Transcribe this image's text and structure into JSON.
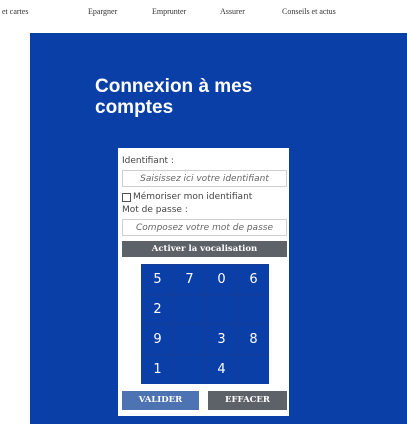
{
  "nav": {
    "items": [
      "et cartes",
      "Epargner",
      "Emprunter",
      "Assurer",
      "Conseils et actus"
    ]
  },
  "login": {
    "title": "Connexion à mes comptes",
    "identifier_label": "Identifiant :",
    "identifier_placeholder": "Saisissez ici votre identifiant",
    "remember_label": "Mémoriser mon identifiant",
    "remember_checked": false,
    "password_label": "Mot de passe :",
    "password_placeholder": "Composez votre mot de passe",
    "vocalisation_label": "Activer la vocalisation",
    "keypad": [
      "5",
      "7",
      "0",
      "6",
      "2",
      "",
      "",
      "",
      "9",
      "",
      "3",
      "8",
      "1",
      "",
      "4",
      ""
    ],
    "validate_label": "VALIDER",
    "clear_label": "EFFACER"
  },
  "colors": {
    "hero_blue": "#0b3fa8",
    "button_grey": "#5d6168",
    "validate_blue": "#4d73b3"
  }
}
